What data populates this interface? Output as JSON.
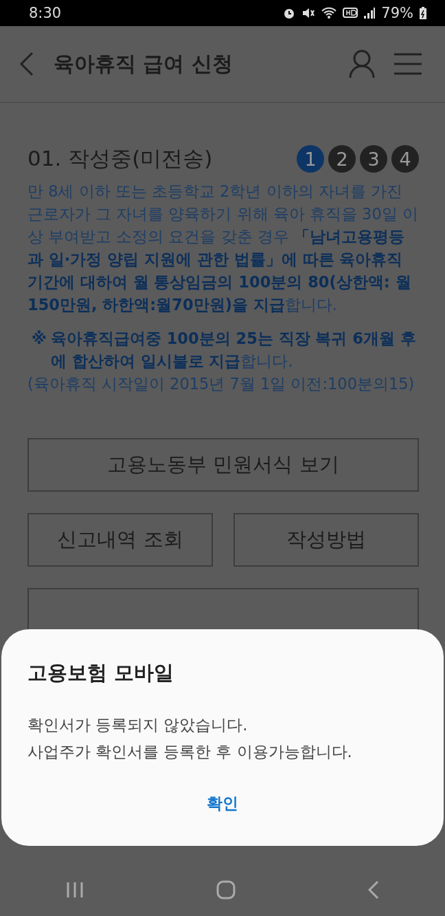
{
  "status_bar": {
    "time": "8:30",
    "battery": "79%"
  },
  "header": {
    "title": "육아휴직 급여 신청"
  },
  "section": {
    "title": "01. 작성중(미전송)",
    "steps": [
      {
        "label": "1",
        "selected": true
      },
      {
        "label": "2",
        "selected": false
      },
      {
        "label": "3",
        "selected": false
      },
      {
        "label": "4",
        "selected": false
      }
    ],
    "description": "만 8세 이하 또는 초등학교 2학년 이하의 자녀를 가진 근로자가 그 자녀를 양육하기 위해 육아 휴직을 30일 이상 부여받고 소정의 요건을 갖춘 경우 **「남녀고용평등과 일·가정 양립 지원에 관한 법률」에 따른 육아휴직 기간에 대하여 월 통상임금의 100분의 80(상한액: 월 150만원, 하한액:월70만원)을 지급**합니다.",
    "note_mark": "※",
    "note": "**육아휴직급여중 100분의 25는 직장 복귀 6개월 후에 합산하여 일시불로 지급**합니다.",
    "footnote": "(육아휴직 시작일이 2015년 7월 1일 이전:100분의15)"
  },
  "buttons": [
    {
      "label": "고용노동부 민원서식 보기",
      "kind": "wide"
    },
    {
      "label": "신고내역 조회",
      "kind": "half"
    },
    {
      "label": "작성방법",
      "kind": "half"
    }
  ],
  "dialog": {
    "title": "고용보험 모바일",
    "message": [
      "확인서가 등록되지 않았습니다.",
      "사업주가 확인서를 등록한 후 이용가능합니다."
    ],
    "confirm": "확인"
  }
}
